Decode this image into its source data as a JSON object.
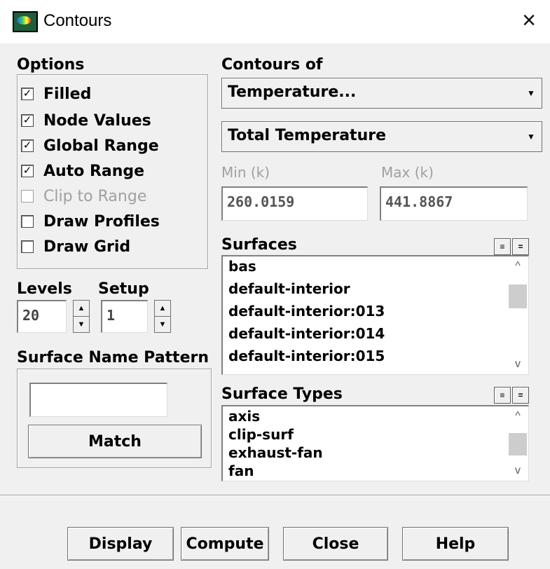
{
  "window": {
    "title": "Contours",
    "close_label": "×"
  },
  "options": {
    "label": "Options",
    "checkboxes": [
      {
        "label": "Filled",
        "checked": true,
        "enabled": true
      },
      {
        "label": "Node Values",
        "checked": true,
        "enabled": true
      },
      {
        "label": "Global Range",
        "checked": true,
        "enabled": true
      },
      {
        "label": "Auto Range",
        "checked": true,
        "enabled": true
      },
      {
        "label": "Clip to Range",
        "checked": false,
        "enabled": false
      },
      {
        "label": "Draw Profiles",
        "checked": false,
        "enabled": true
      },
      {
        "label": "Draw Grid",
        "checked": false,
        "enabled": true
      }
    ],
    "check_mark": "✓"
  },
  "levels": {
    "label": "Levels",
    "value": "20"
  },
  "setup": {
    "label": "Setup",
    "value": "1"
  },
  "surface_name_pattern": {
    "label": "Surface Name Pattern",
    "value": "",
    "match_label": "Match"
  },
  "contours_of": {
    "label": "Contours of",
    "category": "Temperature...",
    "variable": "Total Temperature"
  },
  "range": {
    "min_label": "Min (k)",
    "min_value": "260.0159",
    "max_label": "Max (k)",
    "max_value": "441.8867"
  },
  "surfaces": {
    "label": "Surfaces",
    "items": [
      "bas",
      "default-interior",
      "default-interior:013",
      "default-interior:014",
      "default-interior:015"
    ]
  },
  "surface_types": {
    "label": "Surface Types",
    "items": [
      "axis",
      "clip-surf",
      "exhaust-fan",
      "fan"
    ]
  },
  "buttons": {
    "display": "Display",
    "compute": "Compute",
    "close": "Close",
    "help": "Help"
  },
  "icons": {
    "spin_up": "▲",
    "spin_down": "▼",
    "dropdown": "▼",
    "scroll_up": "^",
    "scroll_down": "v",
    "select_all": "≡",
    "deselect_all": "="
  }
}
